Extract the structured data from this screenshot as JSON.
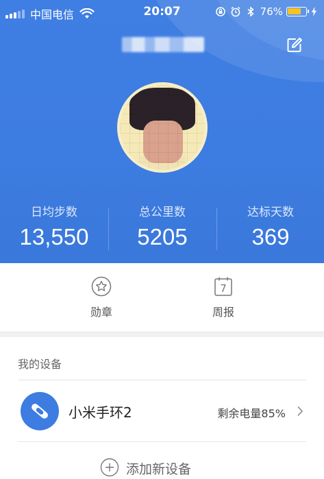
{
  "status_bar": {
    "carrier": "中国电信",
    "time": "20:07",
    "battery_text": "76%",
    "battery_level": 0.76,
    "battery_color": "#f6c324"
  },
  "header": {
    "accent_color": "#3d7ce0",
    "edit_icon": "edit-icon"
  },
  "stats": [
    {
      "label": "日均步数",
      "value": "13,550"
    },
    {
      "label": "总公里数",
      "value": "5205"
    },
    {
      "label": "达标天数",
      "value": "369"
    }
  ],
  "actions": [
    {
      "label": "勋章",
      "icon": "star-medal-icon"
    },
    {
      "label": "周报",
      "icon": "calendar-7-icon",
      "icon_text": "7"
    }
  ],
  "devices": {
    "section_title": "我的设备",
    "items": [
      {
        "name": "小米手环2",
        "battery": "剩余电量85%",
        "icon": "band-icon"
      }
    ],
    "add_label": "添加新设备"
  }
}
